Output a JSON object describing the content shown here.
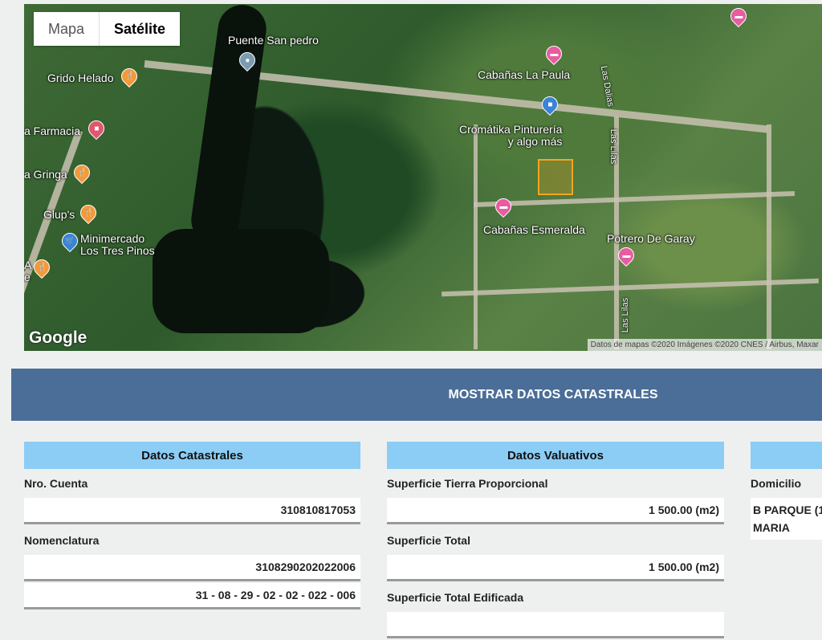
{
  "map": {
    "type_buttons": [
      "Mapa",
      "Satélite"
    ],
    "selected": "Satélite",
    "logo": "Google",
    "attribution": "Datos de mapas ©2020 Imágenes ©2020 CNES / Airbus, Maxar",
    "places": [
      {
        "name": "Puente San pedro",
        "icon": "pin-icon",
        "color": "#7a9bb0"
      },
      {
        "name": "Grido Helado",
        "icon": "food-icon",
        "color": "#f29a3a"
      },
      {
        "name": "a Farmacia",
        "icon": "shopping-icon",
        "color": "#e0566f"
      },
      {
        "name": "a Gringa",
        "icon": "food-icon",
        "color": "#f29a3a"
      },
      {
        "name": "Glup's",
        "icon": "food-icon",
        "color": "#f29a3a"
      },
      {
        "name": "Minimercado\nLos Tres Pinos",
        "icon": "cart-icon",
        "color": "#3b83d6"
      },
      {
        "name": "A\ne",
        "icon": "food-icon",
        "color": "#f29a3a"
      },
      {
        "name": "Cabañas La Paula",
        "icon": "lodging-icon",
        "color": "#e85ca0"
      },
      {
        "name": "Cromátika Pinturería\ny algo más",
        "icon": "shopping-icon",
        "color": "#3b83d6"
      },
      {
        "name": "Cabañas Esmeralda",
        "icon": "lodging-icon",
        "color": "#e85ca0"
      },
      {
        "name": "Potrero De Garay",
        "icon": "lodging-icon",
        "color": "#e85ca0"
      },
      {
        "name": "",
        "icon": "lodging-icon",
        "color": "#e85ca0"
      }
    ],
    "streets": [
      "Las Dalias",
      "Las Lilas",
      "Las Lilas"
    ]
  },
  "banner": {
    "label": "MOSTRAR DATOS CATASTRALES"
  },
  "catastrales": {
    "title": "Datos Catastrales",
    "fields": [
      {
        "label": "Nro. Cuenta",
        "values": [
          "310810817053"
        ]
      },
      {
        "label": "Nomenclatura",
        "values": [
          "3108290202022006",
          "31 - 08 - 29 - 02 - 02 - 022 - 006"
        ]
      }
    ]
  },
  "valuativos": {
    "title": "Datos Valuativos",
    "fields": [
      {
        "label": "Superficie Tierra Proporcional",
        "values": [
          "1 500.00 (m2)"
        ]
      },
      {
        "label": "Superficie Total",
        "values": [
          "1 500.00 (m2)"
        ]
      },
      {
        "label": "Superficie Total Edificada",
        "values": [
          ""
        ]
      }
    ]
  },
  "third": {
    "title": "",
    "domicilio_label": "Domicilio",
    "domicilio_value": "B PARQUE (1\nMARIA"
  }
}
